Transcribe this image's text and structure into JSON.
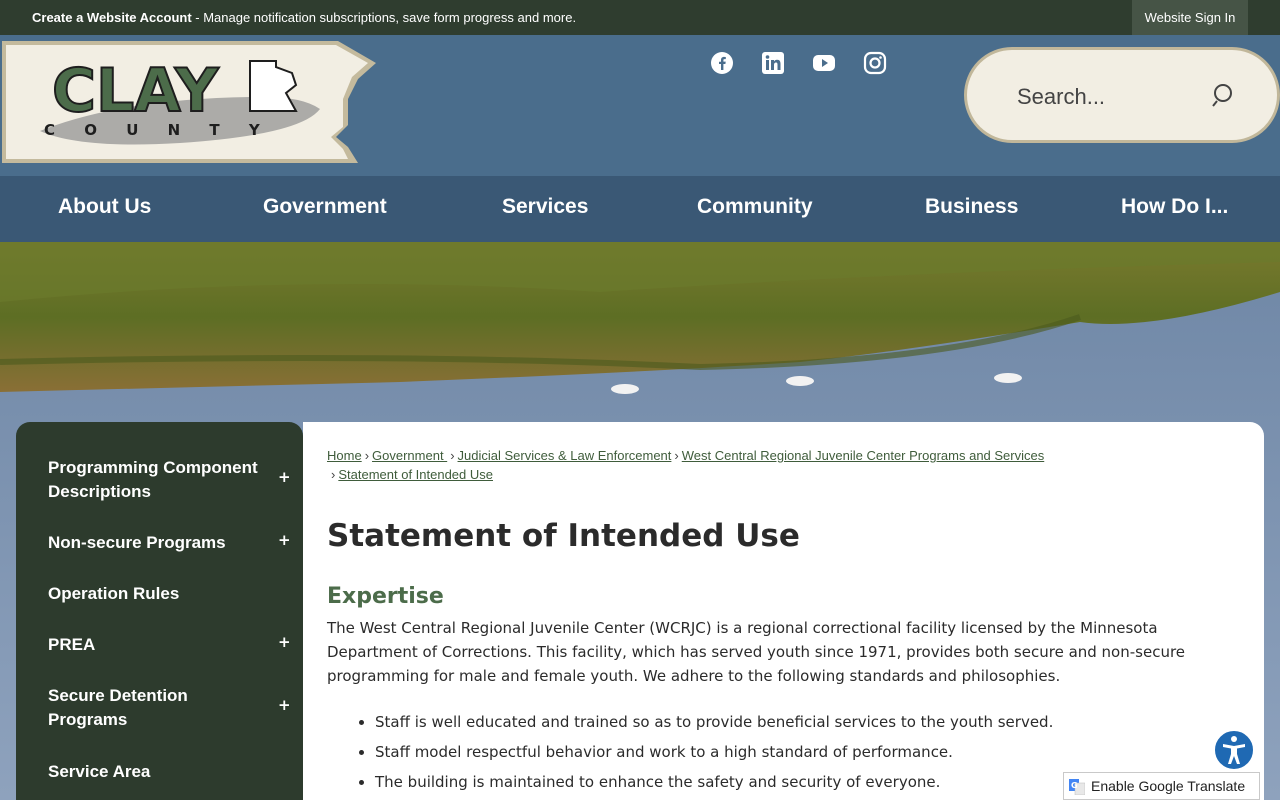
{
  "topbar": {
    "account_link": "Create a Website Account",
    "account_desc": " - Manage notification subscriptions, save form progress and more.",
    "signin": "Website Sign In"
  },
  "logo": {
    "line1": "CLAY",
    "line2": "C O U N T Y"
  },
  "social": [
    "facebook-icon",
    "linkedin-icon",
    "youtube-icon",
    "instagram-icon"
  ],
  "search": {
    "placeholder": "Search..."
  },
  "nav": [
    "About Us",
    "Government",
    "Services",
    "Community",
    "Business",
    "How Do I..."
  ],
  "sidebar": {
    "items": [
      {
        "label": "Programming Component Descriptions",
        "toggle": "+"
      },
      {
        "label": "Non-secure Programs",
        "toggle": "+"
      },
      {
        "label": "Operation Rules",
        "toggle": ""
      },
      {
        "label": "PREA",
        "toggle": "+"
      },
      {
        "label": "Secure Detention Programs",
        "toggle": "+"
      },
      {
        "label": "Service Area",
        "toggle": ""
      }
    ]
  },
  "breadcrumb": {
    "items": [
      "Home",
      "Government ",
      "Judicial Services & Law Enforcement",
      "West Central Regional Juvenile Center Programs and Services",
      "Statement of Intended Use"
    ]
  },
  "page": {
    "title": "Statement of Intended Use",
    "section": "Expertise",
    "paragraph": "The West Central Regional Juvenile Center (WCRJC) is a regional correctional facility licensed by the Minnesota Department of Corrections. This facility, which has served youth since 1971, provides both secure and non-secure programming for male and female youth. We adhere to the following standards and philosophies.",
    "bullets": [
      "Staff is well educated and trained so as to provide beneficial services to the youth served.",
      "Staff model respectful behavior and work to a high standard of performance.",
      "The building is maintained to enhance the safety and security of everyone."
    ]
  },
  "translate": {
    "label": "Enable Google Translate"
  },
  "colors": {
    "topbar": "#2f3d2f",
    "header": "#4a6d8c",
    "nav": "#3a5875",
    "sidebar": "#2d3b2d",
    "accent": "#4c6c4a"
  }
}
